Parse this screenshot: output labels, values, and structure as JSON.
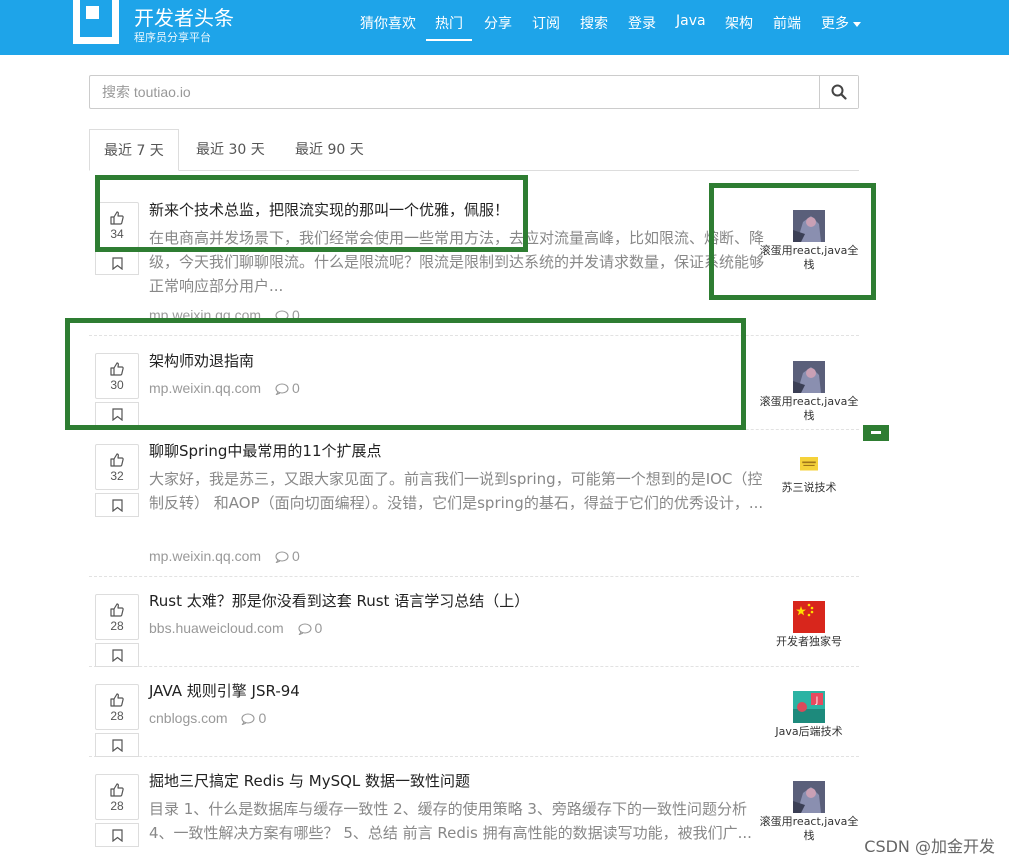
{
  "brand": {
    "name": "开发者头条",
    "subtitle": "程序员分享平台"
  },
  "nav": {
    "items": [
      "猜你喜欢",
      "热门",
      "分享",
      "订阅",
      "搜索",
      "登录",
      "Java",
      "架构",
      "前端"
    ],
    "more_label": "更多",
    "active": "热门"
  },
  "search": {
    "placeholder": "搜索 toutiao.io"
  },
  "tabs": [
    "最近 7 天",
    "最近 30 天",
    "最近 90 天"
  ],
  "active_tab": "最近 7 天",
  "items": [
    {
      "votes": "34",
      "title": "新来个技术总监，把限流实现的那叫一个优雅，佩服！",
      "summary": "在电商高并发场景下，我们经常会使用一些常用方法，去应对流量高峰，比如限流、熔断、降级，今天我们聊聊限流。什么是限流呢？限流是限制到达系统的并发请求数量，保证系统能够正常响应部分用户...",
      "source": "mp.weixin.qq.com",
      "comments": "0",
      "author": "滚蛋用react,java全栈"
    },
    {
      "votes": "30",
      "title": "架构师劝退指南",
      "summary": "",
      "source": "mp.weixin.qq.com",
      "comments": "0",
      "author": "滚蛋用react,java全栈"
    },
    {
      "votes": "32",
      "title": "聊聊Spring中最常用的11个扩展点",
      "summary": "大家好，我是苏三，又跟大家见面了。前言我们一说到spring，可能第一个想到的是IOC（控制反转） 和AOP（面向切面编程）。没错，它们是spring的基石，得益于它们的优秀设计，...",
      "source": "mp.weixin.qq.com",
      "comments": "0",
      "author": "苏三说技术"
    },
    {
      "votes": "28",
      "title": "Rust 太难？那是你没看到这套 Rust 语言学习总结（上）",
      "summary": "",
      "source": "bbs.huaweicloud.com",
      "comments": "0",
      "author": "开发者独家号"
    },
    {
      "votes": "28",
      "title": "JAVA 规则引擎 JSR-94",
      "summary": "",
      "source": "cnblogs.com",
      "comments": "0",
      "author": "Java后端技术"
    },
    {
      "votes": "28",
      "title": "掘地三尺搞定 Redis 与 MySQL 数据一致性问题",
      "summary": "目录 1、什么是数据库与缓存一致性 2、缓存的使用策略 3、旁路缓存下的一致性问题分析 4、一致性解决方案有哪些？ 5、总结 前言 Redis 拥有高性能的数据读写功能，被我们广...",
      "source": "",
      "comments": "",
      "author": "滚蛋用react,java全栈"
    }
  ],
  "watermark": "CSDN @加金开发",
  "colors": {
    "header": "#1ea4e9",
    "annotation": "#2e7d32"
  }
}
